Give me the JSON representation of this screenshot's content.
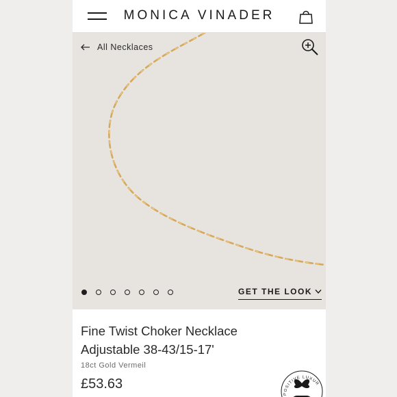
{
  "header": {
    "brand": "MONICA VINADER",
    "menu_icon": "hamburger-menu-icon",
    "bag_icon": "shopping-bag-icon"
  },
  "hero": {
    "back_label": "All Necklaces",
    "back_icon": "arrow-left-icon",
    "zoom_icon": "zoom-in-icon",
    "image_count": 7,
    "active_image": 1,
    "get_the_look": "GET THE LOOK",
    "chain_color": "#d6a85a"
  },
  "product": {
    "title_line1": "Fine Twist Choker Necklace",
    "title_line2": "Adjustable 38-43/15-17'",
    "material": "18ct Gold Vermeil",
    "price": "£53.63"
  },
  "badge": {
    "text": "POSITIVE LUXURY",
    "icon": "butterfly-icon"
  },
  "colors": {
    "text": "#1a1a1a",
    "hero_background": "#e7e4e0",
    "chain": "#d6a85a"
  }
}
